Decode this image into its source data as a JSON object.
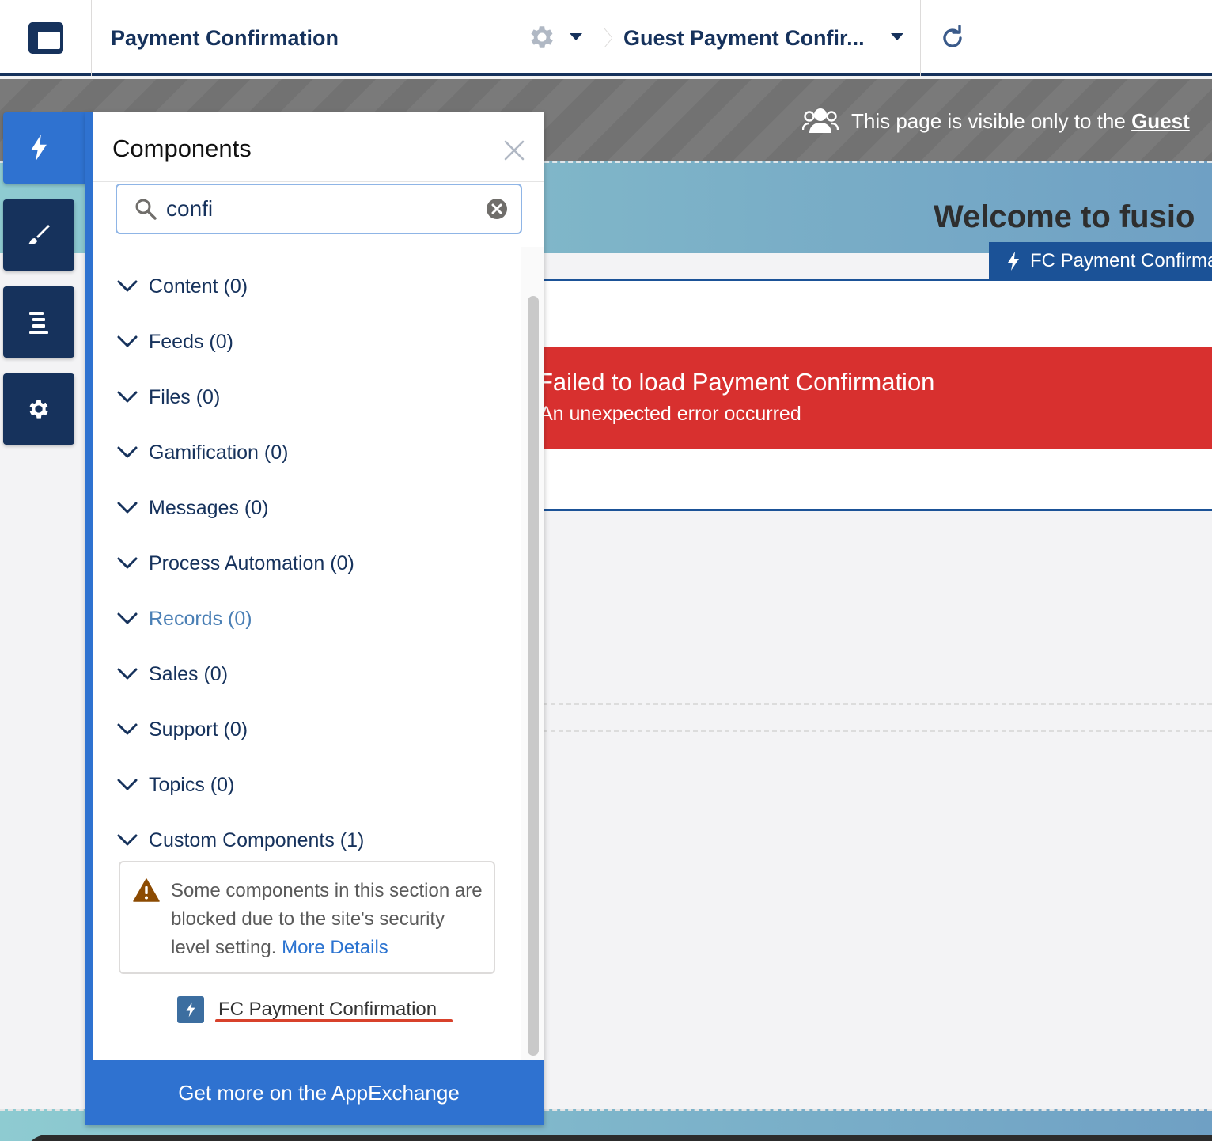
{
  "topbar": {
    "page_title": "Payment Confirmation",
    "audience_title": "Guest Payment Confir..."
  },
  "banner": {
    "visibility_text": "This page is visible only to the ",
    "visibility_link": "Guest"
  },
  "hero": {
    "title": "Welcome to fusio"
  },
  "component_tag": {
    "label": "FC Payment Confirma"
  },
  "error": {
    "title": "Failed to load Payment Confirmation",
    "message": "An unexpected error occurred"
  },
  "panel": {
    "title": "Components",
    "search_value": "confi",
    "categories": [
      {
        "label": "Content (0)"
      },
      {
        "label": "Feeds (0)"
      },
      {
        "label": "Files (0)"
      },
      {
        "label": "Gamification (0)"
      },
      {
        "label": "Messages (0)"
      },
      {
        "label": "Process Automation (0)"
      },
      {
        "label": "Records (0)"
      },
      {
        "label": "Sales (0)"
      },
      {
        "label": "Support (0)"
      },
      {
        "label": "Topics (0)"
      },
      {
        "label": "Custom Components (1)"
      }
    ],
    "warning_text": "Some components in this section are blocked due to the site's security level setting. ",
    "warning_link": "More Details",
    "custom_item": "FC Payment Confirmation",
    "footer": "Get more on the AppExchange"
  },
  "colors": {
    "brand_dark": "#16325c",
    "brand_blue": "#2f72d0",
    "error_red": "#d8302f",
    "highlight_underline": "#d8412b"
  },
  "icons": {
    "app_logo": "layout-icon",
    "settings": "gear-icon",
    "refresh": "refresh-icon",
    "rail": [
      "lightning-icon",
      "brush-icon",
      "list-icon",
      "gear-icon"
    ]
  }
}
